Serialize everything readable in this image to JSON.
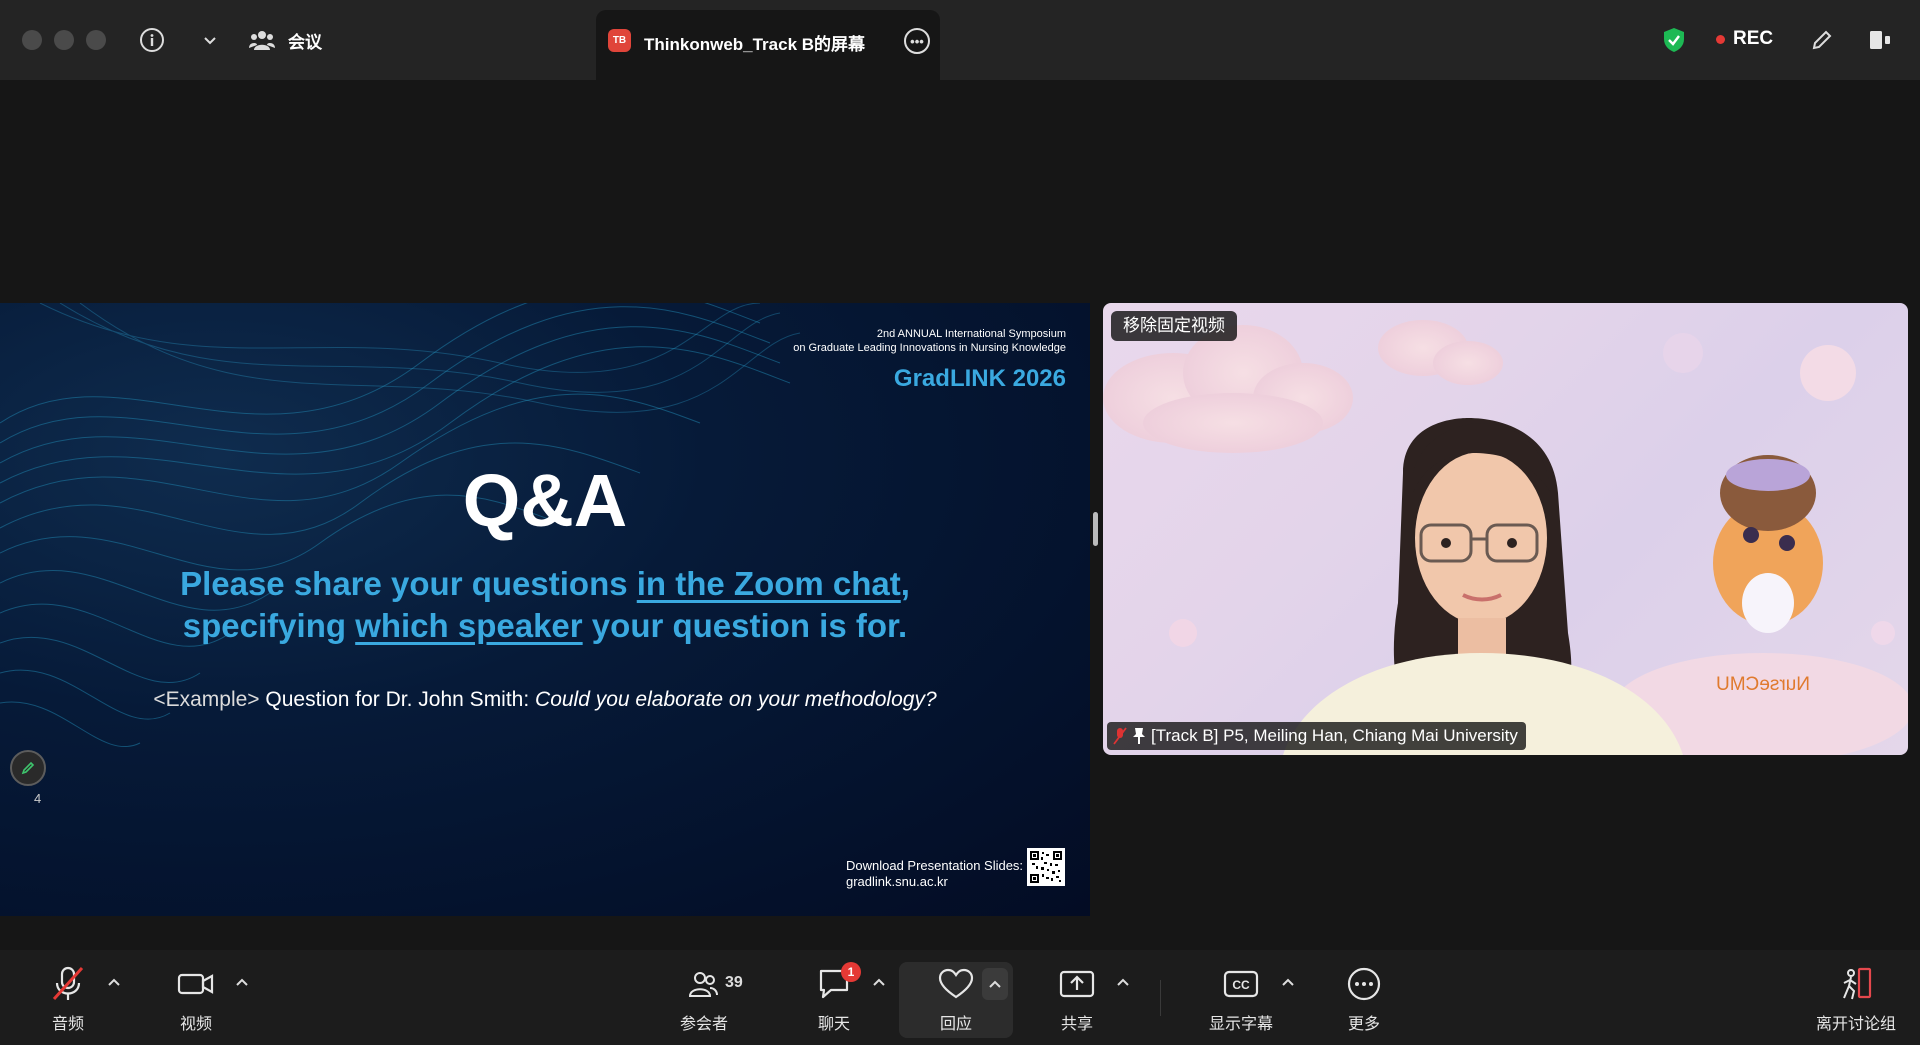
{
  "titlebar": {
    "meeting_label": "会议",
    "share_tab_badge": "TB",
    "share_tab_title": "Thinkonweb_Track B的屏幕",
    "rec_label": "REC",
    "security_color": "#1db954",
    "rec_color": "#e53935"
  },
  "slide": {
    "symposium_line1": "2nd ANNUAL International Symposium",
    "symposium_line2": "on Graduate Leading Innovations in Nursing Knowledge",
    "brand": "GradLINK 2026",
    "title": "Q&A",
    "line1_a": "Please share your questions ",
    "line1_link": "in the Zoom chat",
    "line1_b": ",",
    "line2_a": "specifying ",
    "line2_link": "which speaker",
    "line2_b": " your question is for.",
    "example_tag": "<Example>",
    "example_text": " Question for Dr. John Smith: ",
    "example_italic": "Could you elaborate on your methodology?",
    "download_label": "Download Presentation Slides:",
    "download_url": "gradlink.snu.ac.kr",
    "accent_color": "#3aa9e0"
  },
  "annotation": {
    "count": "4"
  },
  "video": {
    "unpin_label": "移除固定视频",
    "participant_name": "[Track B] P5, Meiling Han, Chiang Mai University",
    "mascot_text": "NurseCMU"
  },
  "toolbar": {
    "audio": "音频",
    "video": "视频",
    "participants": "参会者",
    "participants_count": "39",
    "chat": "聊天",
    "chat_badge": "1",
    "react": "回应",
    "share": "共享",
    "captions": "显示字幕",
    "more": "更多",
    "leave_breakout": "离开讨论组"
  }
}
